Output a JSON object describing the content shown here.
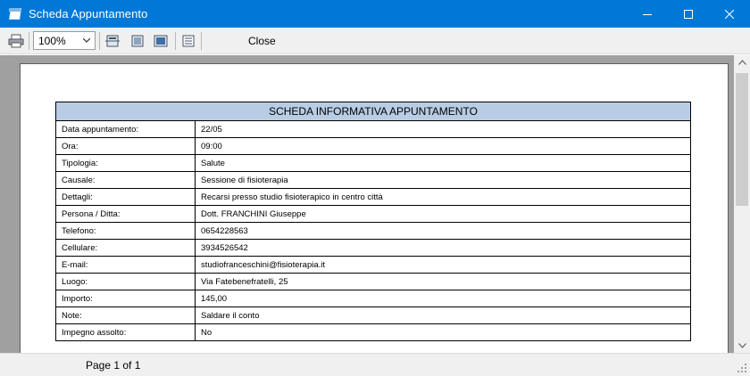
{
  "window": {
    "title": "Scheda Appuntamento",
    "minimize_icon": "minimize-icon",
    "maximize_icon": "maximize-icon",
    "close_icon": "close-icon"
  },
  "toolbar": {
    "print_icon": "printer-icon",
    "zoom_value": "100%",
    "close_label": "Close"
  },
  "document": {
    "heading": "SCHEDA INFORMATIVA APPUNTAMENTO",
    "rows": [
      {
        "label": "Data appuntamento:",
        "value": "22/05"
      },
      {
        "label": "Ora:",
        "value": "09:00"
      },
      {
        "label": "Tipologia:",
        "value": "Salute"
      },
      {
        "label": "Causale:",
        "value": "Sessione di fisioterapia"
      },
      {
        "label": "Dettagli:",
        "value": "Recarsi presso studio fisioterapico in centro città"
      },
      {
        "label": "Persona / Ditta:",
        "value": "Dott. FRANCHINI Giuseppe"
      },
      {
        "label": "Telefono:",
        "value": "0654228563"
      },
      {
        "label": "Cellulare:",
        "value": "3934526542"
      },
      {
        "label": "E-mail:",
        "value": "studiofranceschini@fisioterapia.it"
      },
      {
        "label": "Luogo:",
        "value": "Via Fatebenefratelli, 25"
      },
      {
        "label": "Importo:",
        "value": "145,00"
      },
      {
        "label": "Note:",
        "value": "Saldare il conto"
      },
      {
        "label": "Impegno assolto:",
        "value": "No"
      }
    ]
  },
  "status": {
    "page_info": "Page 1 of 1"
  },
  "colors": {
    "titlebar": "#0078d7",
    "table_header": "#b8cce4",
    "preview_background": "#a0a0a0"
  }
}
